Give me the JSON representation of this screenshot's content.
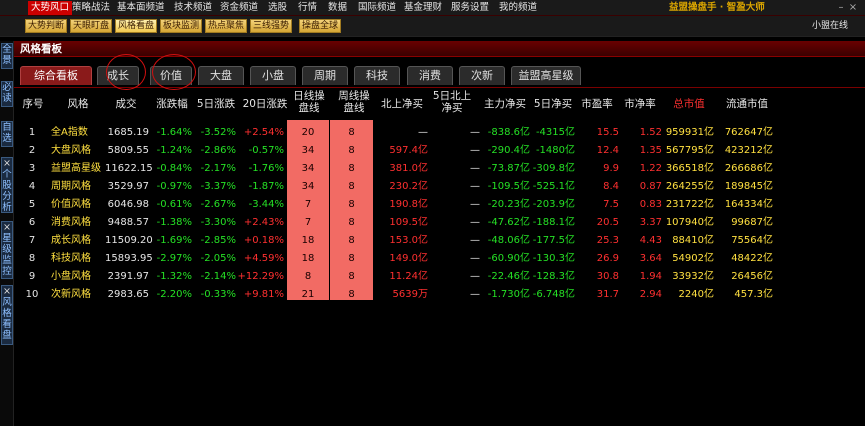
{
  "menu": {
    "items": [
      "大势风口",
      "策略战法",
      "基本面频道",
      "技术频道",
      "资金频道",
      "选股",
      "行情",
      "数据",
      "国际频道",
      "基金理财",
      "服务设置",
      "我的频道"
    ],
    "brand": "益盟操盘手 · 智盈大师"
  },
  "toolbar": {
    "buttons": [
      "大势判断",
      "天眼盯盘",
      "风格看盘",
      "板块监测",
      "热点聚焦",
      "三线强势",
      "操盘全球"
    ],
    "right_text": "小盟在线"
  },
  "panel": {
    "title": "风格看板"
  },
  "left_tabs": [
    {
      "close": "",
      "label": "全景"
    },
    {
      "close": "",
      "label": "必读"
    },
    {
      "close": "",
      "label": "自选"
    },
    {
      "close": "×",
      "label": "个股分析"
    },
    {
      "close": "×",
      "label": "星级监控"
    },
    {
      "close": "×",
      "label": "风格看盘"
    }
  ],
  "tabs": [
    "综合看板",
    "成长",
    "价值",
    "大盘",
    "小盘",
    "周期",
    "科技",
    "消费",
    "次新",
    "益盟高星级"
  ],
  "columns": [
    "序号",
    "风格",
    "成交",
    "涨跌幅",
    "5日涨跌",
    "20日涨跌",
    "日线操盘线",
    "周线操盘线",
    "北上净买",
    "5日北上净买",
    "主力净买",
    "5日净买",
    "市盈率",
    "市净率",
    "总市值",
    "流通市值"
  ],
  "rows": [
    {
      "no": "1",
      "name": "全A指数",
      "vol": "1685.19",
      "chg": "-1.64%",
      "chg5": "-3.52%",
      "chg20": "+2.54%",
      "day": "20",
      "week": "8",
      "north": "—",
      "north5": "—",
      "main": "-838.6亿",
      "main5": "-4315亿",
      "pe": "15.5",
      "pb": "1.52",
      "cap": "959931亿",
      "fcap": "762647亿"
    },
    {
      "no": "2",
      "name": "大盘风格",
      "vol": "5809.55",
      "chg": "-1.24%",
      "chg5": "-2.86%",
      "chg20": "-0.57%",
      "day": "34",
      "week": "8",
      "north": "597.4亿",
      "north5": "—",
      "main": "-290.4亿",
      "main5": "-1480亿",
      "pe": "12.4",
      "pb": "1.35",
      "cap": "567795亿",
      "fcap": "423212亿"
    },
    {
      "no": "3",
      "name": "益盟高星级",
      "vol": "11622.15",
      "chg": "-0.84%",
      "chg5": "-2.17%",
      "chg20": "-1.76%",
      "day": "34",
      "week": "8",
      "north": "381.0亿",
      "north5": "—",
      "main": "-73.87亿",
      "main5": "-309.8亿",
      "pe": "9.9",
      "pb": "1.22",
      "cap": "366518亿",
      "fcap": "266686亿"
    },
    {
      "no": "4",
      "name": "周期风格",
      "vol": "3529.97",
      "chg": "-0.97%",
      "chg5": "-3.37%",
      "chg20": "-1.87%",
      "day": "34",
      "week": "8",
      "north": "230.2亿",
      "north5": "—",
      "main": "-109.5亿",
      "main5": "-525.1亿",
      "pe": "8.4",
      "pb": "0.87",
      "cap": "264255亿",
      "fcap": "189845亿"
    },
    {
      "no": "5",
      "name": "价值风格",
      "vol": "6046.98",
      "chg": "-0.61%",
      "chg5": "-2.67%",
      "chg20": "-3.44%",
      "day": "7",
      "week": "8",
      "north": "190.8亿",
      "north5": "—",
      "main": "-20.23亿",
      "main5": "-203.9亿",
      "pe": "7.5",
      "pb": "0.83",
      "cap": "231722亿",
      "fcap": "164334亿"
    },
    {
      "no": "6",
      "name": "消费风格",
      "vol": "9488.57",
      "chg": "-1.38%",
      "chg5": "-3.30%",
      "chg20": "+2.43%",
      "day": "7",
      "week": "8",
      "north": "109.5亿",
      "north5": "—",
      "main": "-47.62亿",
      "main5": "-188.1亿",
      "pe": "20.5",
      "pb": "3.37",
      "cap": "107940亿",
      "fcap": "99687亿"
    },
    {
      "no": "7",
      "name": "成长风格",
      "vol": "11509.20",
      "chg": "-1.69%",
      "chg5": "-2.85%",
      "chg20": "+0.18%",
      "day": "18",
      "week": "8",
      "north": "153.0亿",
      "north5": "—",
      "main": "-48.06亿",
      "main5": "-177.5亿",
      "pe": "25.3",
      "pb": "4.43",
      "cap": "88410亿",
      "fcap": "75564亿"
    },
    {
      "no": "8",
      "name": "科技风格",
      "vol": "15893.95",
      "chg": "-2.97%",
      "chg5": "-2.05%",
      "chg20": "+4.59%",
      "day": "18",
      "week": "8",
      "north": "149.0亿",
      "north5": "—",
      "main": "-60.90亿",
      "main5": "-130.3亿",
      "pe": "26.9",
      "pb": "3.64",
      "cap": "54902亿",
      "fcap": "48422亿"
    },
    {
      "no": "9",
      "name": "小盘风格",
      "vol": "2391.97",
      "chg": "-1.32%",
      "chg5": "-2.14%",
      "chg20": "+12.29%",
      "day": "8",
      "week": "8",
      "north": "11.24亿",
      "north5": "—",
      "main": "-22.46亿",
      "main5": "-128.3亿",
      "pe": "30.8",
      "pb": "1.94",
      "cap": "33932亿",
      "fcap": "26456亿"
    },
    {
      "no": "10",
      "name": "次新风格",
      "vol": "2983.65",
      "chg": "-2.20%",
      "chg5": "-0.33%",
      "chg20": "+9.81%",
      "day": "21",
      "week": "8",
      "north": "5639万",
      "north5": "—",
      "main": "-1.730亿",
      "main5": "-6.748亿",
      "pe": "31.7",
      "pb": "2.94",
      "cap": "2240亿",
      "fcap": "457.3亿"
    }
  ],
  "colors": {
    "up": "#ff3030",
    "down": "#25e025",
    "name": "#ffe040",
    "highlight": "#f26b64",
    "accent": "#c00000"
  }
}
